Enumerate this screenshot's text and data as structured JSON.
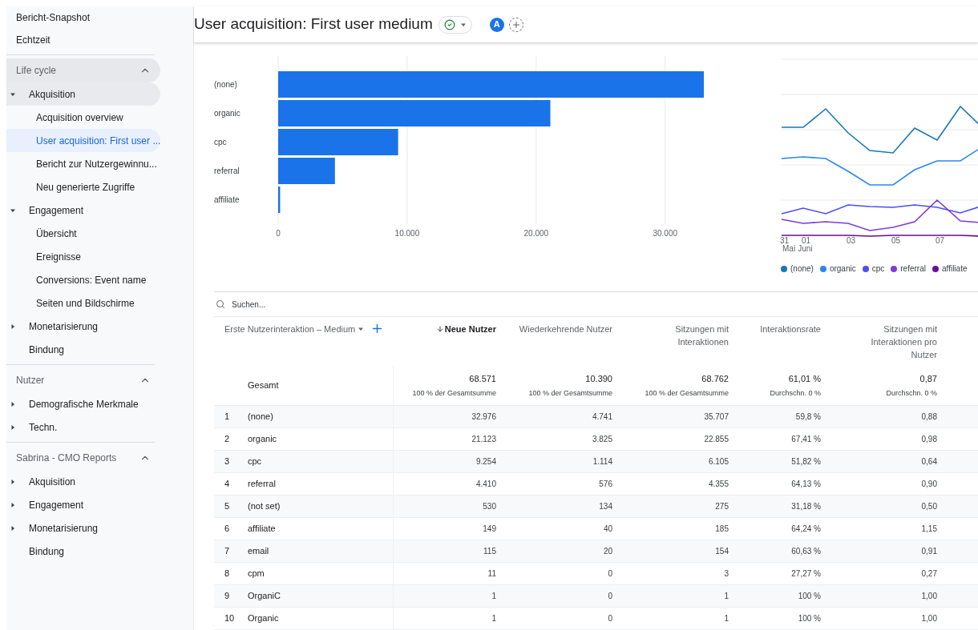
{
  "sidebar": {
    "top_links": [
      {
        "label": "Bericht-Snapshot"
      },
      {
        "label": "Echtzeit"
      }
    ],
    "sections": [
      {
        "title": "Life cycle",
        "expanded": true,
        "highlighted": true,
        "items": [
          {
            "label": "Akquisition",
            "expanded": true,
            "highlighted": true,
            "children": [
              {
                "label": "Acquisition overview",
                "selected": false
              },
              {
                "label": "User acquisition: First user ...",
                "selected": true
              },
              {
                "label": "Bericht zur Nutzergewinnu...",
                "selected": false
              },
              {
                "label": "Neu generierte Zugriffe",
                "selected": false
              }
            ]
          },
          {
            "label": "Engagement",
            "expanded": true,
            "highlighted": false,
            "children": [
              {
                "label": "Übersicht",
                "selected": false
              },
              {
                "label": "Ereignisse",
                "selected": false
              },
              {
                "label": "Conversions: Event name",
                "selected": false
              },
              {
                "label": "Seiten und Bildschirme",
                "selected": false
              }
            ]
          },
          {
            "label": "Monetarisierung",
            "expanded": false,
            "highlighted": false
          },
          {
            "label": "Bindung",
            "highlighted": false
          }
        ]
      },
      {
        "title": "Nutzer",
        "expanded": true,
        "highlighted": false,
        "items": [
          {
            "label": "Demografische Merkmale",
            "expanded": false,
            "highlighted": false
          },
          {
            "label": "Techn.",
            "expanded": false,
            "highlighted": false
          }
        ]
      },
      {
        "title": "Sabrina - CMO Reports",
        "expanded": true,
        "highlighted": false,
        "items": [
          {
            "label": "Akquisition",
            "expanded": false,
            "highlighted": false
          },
          {
            "label": "Engagement",
            "expanded": false,
            "highlighted": false
          },
          {
            "label": "Monetarisierung",
            "expanded": false,
            "highlighted": false
          },
          {
            "label": "Bindung",
            "highlighted": false
          }
        ]
      }
    ]
  },
  "header": {
    "title": "User acquisition: First user medium",
    "avatar": "A"
  },
  "bar_chart": {
    "chart_data": {
      "type": "bar",
      "orientation": "horizontal",
      "categories": [
        "(none)",
        "organic",
        "cpc",
        "referral",
        "affiliate"
      ],
      "series": [
        {
          "color": "#1a73e8",
          "values": [
            33000,
            21100,
            9300,
            4400,
            150
          ]
        }
      ],
      "grid": true,
      "xlim": [
        0,
        33000
      ],
      "xticks": [
        {
          "value": 0,
          "label": "0"
        },
        {
          "value": 10000,
          "label": "10.000"
        },
        {
          "value": 20000,
          "label": "20.000"
        },
        {
          "value": 30000,
          "label": "30.000"
        }
      ]
    }
  },
  "trend_chart": {
    "x_labels": [
      "31",
      "01",
      "03",
      "05",
      "07"
    ],
    "month_labels": [
      "Mai",
      "Juni"
    ],
    "legend": [
      {
        "label": "(none)",
        "color": "#1877b4"
      },
      {
        "label": "organic",
        "color": "#2b86f0"
      },
      {
        "label": "cpc",
        "color": "#4b4ef0"
      },
      {
        "label": "referral",
        "color": "#7d3bdc"
      },
      {
        "label": "affiliate",
        "color": "#6a0f9a"
      }
    ]
  },
  "table": {
    "search_placeholder": "Suchen...",
    "dimension_label": "Erste Nutzerinteraktion – Medium",
    "columns": [
      {
        "label": "Neue Nutzer",
        "sorted": true
      },
      {
        "label": "Wiederkehrende Nutzer",
        "sorted": false
      },
      {
        "label": "Sitzungen mit Interaktionen",
        "sorted": false
      },
      {
        "label": "Interaktionsrate",
        "sorted": false
      },
      {
        "label": "Sitzungen mit Interaktionen pro Nutzer",
        "sorted": false
      }
    ],
    "totals": {
      "label": "Gesamt",
      "cells": [
        {
          "value": "68.571",
          "note": "100 % der Gesamtsumme"
        },
        {
          "value": "10.390",
          "note": "100 % der Gesamtsumme"
        },
        {
          "value": "68.762",
          "note": "100 % der Gesamtsumme"
        },
        {
          "value": "61,01 %",
          "note": "Durchschn. 0 %"
        },
        {
          "value": "0,87",
          "note": "Durchschn. 0 %"
        }
      ]
    },
    "rows": [
      {
        "index": "1",
        "medium": "(none)",
        "values": [
          "32.976",
          "4.741",
          "35.707",
          "59,8 %",
          "0,88"
        ]
      },
      {
        "index": "2",
        "medium": "organic",
        "values": [
          "21.123",
          "3.825",
          "22.855",
          "67,41 %",
          "0,98"
        ]
      },
      {
        "index": "3",
        "medium": "cpc",
        "values": [
          "9.254",
          "1.114",
          "6.105",
          "51,82 %",
          "0,64"
        ]
      },
      {
        "index": "4",
        "medium": "referral",
        "values": [
          "4.410",
          "576",
          "4.355",
          "64,13 %",
          "0,90"
        ]
      },
      {
        "index": "5",
        "medium": "(not set)",
        "values": [
          "530",
          "134",
          "275",
          "31,18 %",
          "0,50"
        ]
      },
      {
        "index": "6",
        "medium": "affiliate",
        "values": [
          "149",
          "40",
          "185",
          "64,24 %",
          "1,15"
        ]
      },
      {
        "index": "7",
        "medium": "email",
        "values": [
          "115",
          "20",
          "154",
          "60,63 %",
          "0,91"
        ]
      },
      {
        "index": "8",
        "medium": "cpm",
        "values": [
          "11",
          "0",
          "3",
          "27,27 %",
          "0,27"
        ]
      },
      {
        "index": "9",
        "medium": "OrganiC",
        "values": [
          "1",
          "0",
          "1",
          "100 %",
          "1,00"
        ]
      },
      {
        "index": "10",
        "medium": "Organic",
        "values": [
          "1",
          "0",
          "1",
          "100 %",
          "1,00"
        ]
      }
    ]
  }
}
